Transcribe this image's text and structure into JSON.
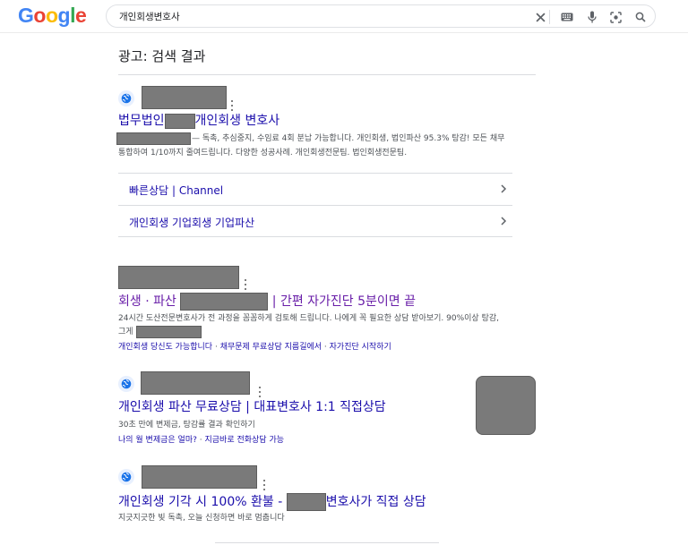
{
  "logo": {
    "letters": [
      {
        "char": "G",
        "color": "#4285F4"
      },
      {
        "char": "o",
        "color": "#EA4335"
      },
      {
        "char": "o",
        "color": "#FBBC05"
      },
      {
        "char": "g",
        "color": "#4285F4"
      },
      {
        "char": "l",
        "color": "#34A853"
      },
      {
        "char": "e",
        "color": "#EA4335"
      }
    ]
  },
  "search": {
    "query": "개인회생변호사",
    "icons": [
      "clear-icon",
      "keyboard-icon",
      "microphone-icon",
      "lens-icon",
      "search-icon"
    ]
  },
  "ads_header": {
    "title": "광고: 검색 결과"
  },
  "results": [
    {
      "title_prefix": "법무법인",
      "title_suffix": "개인회생 변호사",
      "description_line1": "— 독촉, 추심중지, 수임료 4회 분납 가능합니다. 개인회생, 법인파산 95.3% 탕감! 모든 채무",
      "description_line2": "통합하여 1/10까지 줄여드립니다. 다양한 성공사례. 개인회생전문팀. 법인회생전문팀.",
      "sitelinks": [
        {
          "label": "빠른상담 | Channel"
        },
        {
          "label": "개인회생 기업회생 기업파산"
        }
      ]
    },
    {
      "title_prefix": "회생 · 파산",
      "title_suffix": "| 간편 자가진단 5분이면 끝",
      "description_line1": "24시간 도산전문변호사가 전 과정을 꼼꼼하게 검토해 드립니다. 나에게 꼭 필요한 상담 받아보기. 90%이상 탕감,",
      "description_line2": "그게",
      "inline_links": [
        "개인회생 당신도 가능합니다",
        "채무문제 무료상담 지름길에서",
        "자가진단 시작하기"
      ]
    },
    {
      "title": "개인회생 파산 무료상담 | 대표변호사 1:1 직접상담",
      "description_line1": "30초 만에 변제금, 탕감률 결과 확인하기",
      "inline_links": [
        "나의 월 변제금은 얼마?",
        "지금바로 전화상담 가능"
      ]
    },
    {
      "title_prefix": "개인회생 기각 시 100% 환불 -",
      "title_suffix": "변호사가 직접 상담",
      "description_line1": "지긋지긋한 빚 독촉, 오늘 신청하면 바로 멈춥니다"
    }
  ],
  "colors": {
    "link": "#1a0dab",
    "visited": "#681da8",
    "snippet": "#4d5156",
    "redaction": "#7a7a7a"
  }
}
